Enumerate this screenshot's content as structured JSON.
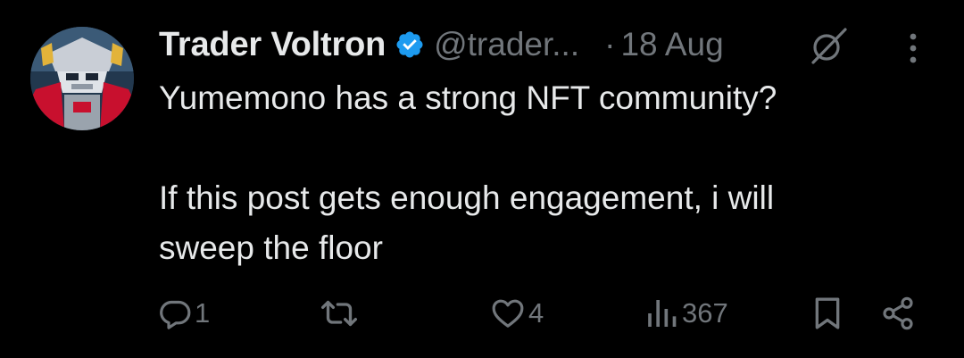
{
  "tweet": {
    "author": {
      "display_name": "Trader Voltron",
      "handle": "@trader...",
      "verified": true,
      "verified_color": "#1d9bf0"
    },
    "separator": "·",
    "date": "18 Aug",
    "body": {
      "line1": "Yumemono has a strong NFT community?",
      "line2": "If this post gets enough engagement, i will",
      "line3": "sweep the floor"
    },
    "actions": {
      "reply": {
        "icon": "reply-icon",
        "count": "1"
      },
      "retweet": {
        "icon": "retweet-icon",
        "count": ""
      },
      "like": {
        "icon": "heart-icon",
        "count": "4"
      },
      "views": {
        "icon": "views-icon",
        "count": "367"
      },
      "bookmark": {
        "icon": "bookmark-icon"
      },
      "share": {
        "icon": "share-icon"
      }
    }
  },
  "colors": {
    "background": "#000000",
    "text_primary": "#e7e9ea",
    "text_secondary": "#71767b",
    "accent": "#1d9bf0"
  }
}
